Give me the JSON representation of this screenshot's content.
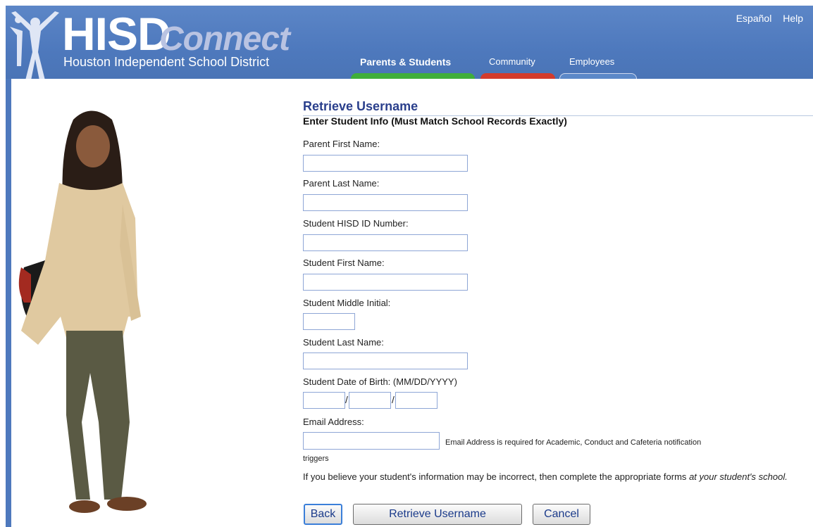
{
  "header": {
    "logo_main": "HISD",
    "logo_accent": "Connect",
    "logo_subtitle": "Houston Independent School District",
    "top_links": [
      "Español",
      "Help"
    ],
    "nav_tabs": [
      {
        "label": "Parents & Students",
        "color": "#3fae3a"
      },
      {
        "label": "Community",
        "color": "#d33b2c"
      },
      {
        "label": "Employees",
        "color": "#5b88c8"
      }
    ]
  },
  "form": {
    "title": "Retrieve Username",
    "subtitle": "Enter Student Info (Must Match School Records Exactly)",
    "fields": {
      "parent_first": {
        "label": "Parent First Name:",
        "value": ""
      },
      "parent_last": {
        "label": "Parent Last Name:",
        "value": ""
      },
      "student_id": {
        "label": "Student HISD ID Number:",
        "value": ""
      },
      "student_first": {
        "label": "Student First Name:",
        "value": ""
      },
      "student_middle": {
        "label": "Student Middle Initial:",
        "value": ""
      },
      "student_last": {
        "label": "Student Last Name:",
        "value": ""
      },
      "dob": {
        "label": "Student Date of Birth: (MM/DD/YYYY)",
        "month": "",
        "day": "",
        "year": "",
        "separator": "/"
      },
      "email": {
        "label": "Email Address:",
        "value": "",
        "note": "Email Address is required for Academic, Conduct and Cafeteria notification",
        "note_cont": "triggers"
      }
    },
    "info_text": "If you believe your student's information may be incorrect, then complete the appropriate forms",
    "info_text_italic": "at your student's school.",
    "buttons": {
      "back": "Back",
      "retrieve": "Retrieve Username",
      "cancel": "Cancel"
    }
  },
  "colors": {
    "header_bg": "#4e79bd",
    "title": "#2a3f8c",
    "input_border": "#8ea6d6"
  }
}
